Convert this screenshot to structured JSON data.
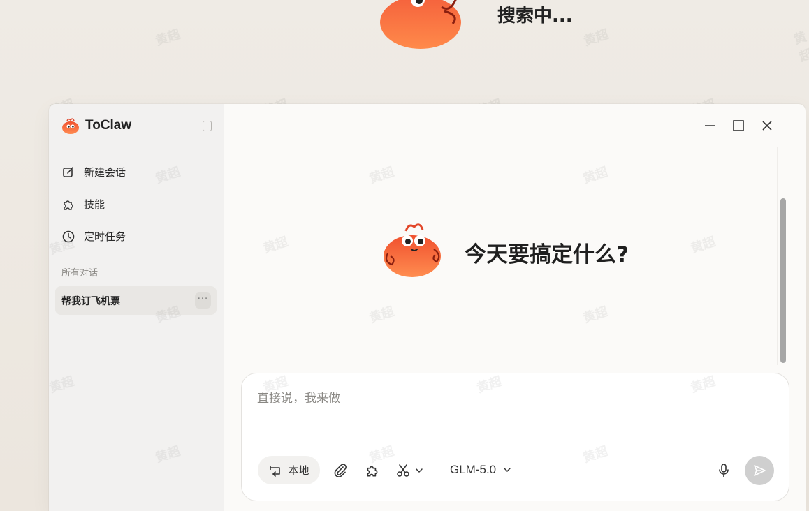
{
  "top_status": {
    "text": "搜索中..."
  },
  "watermark": {
    "text": "黄超"
  },
  "brand": {
    "name": "ToClaw"
  },
  "sidebar": {
    "items": [
      {
        "label": "新建会话",
        "icon": "edit-icon"
      },
      {
        "label": "技能",
        "icon": "puzzle-icon"
      },
      {
        "label": "定时任务",
        "icon": "clock-icon"
      }
    ],
    "section_label": "所有对话",
    "conversations": [
      {
        "title": "帮我订飞机票",
        "more": "···"
      }
    ]
  },
  "main": {
    "greeting": "今天要搞定什么?"
  },
  "composer": {
    "placeholder": "直接说，我来做",
    "local_chip": "本地",
    "model": "GLM-5.0"
  },
  "colors": {
    "mascot": "#f5613c",
    "send_disabled": "#cfcfcf",
    "sidebar_bg": "#f2f1f0"
  }
}
